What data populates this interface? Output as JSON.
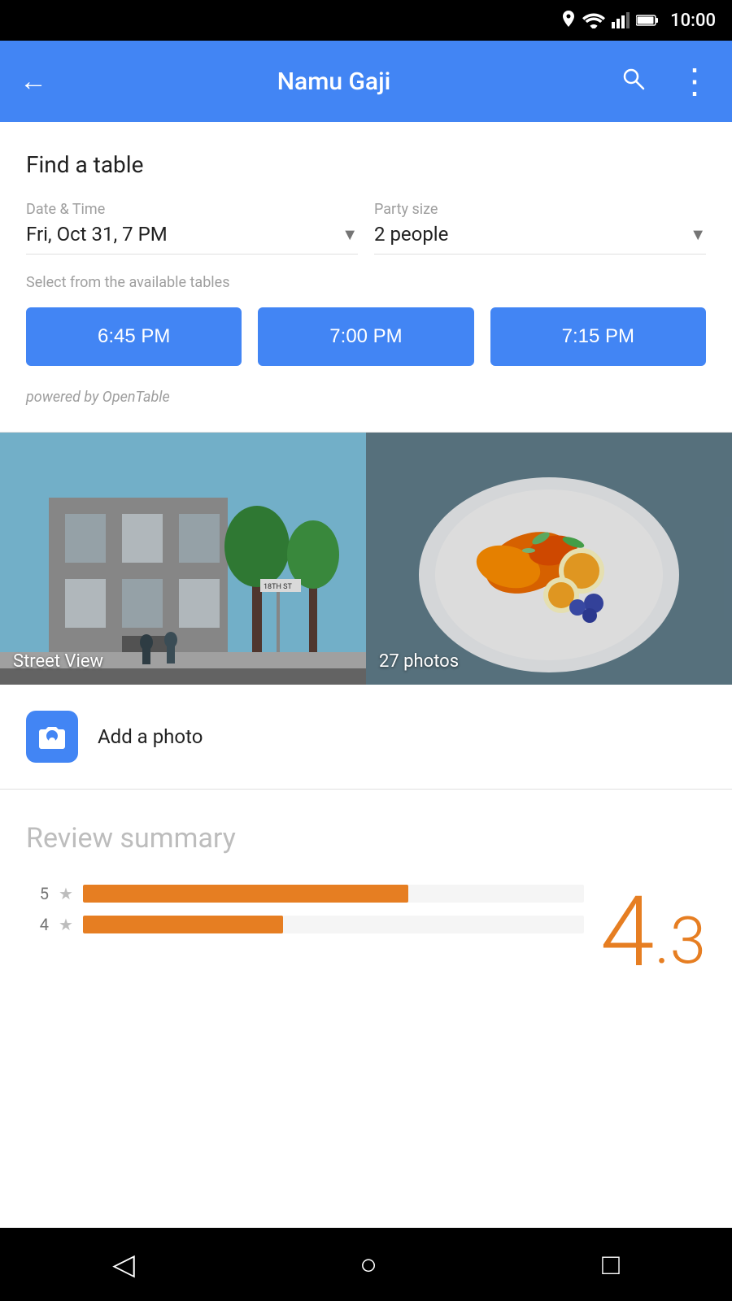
{
  "statusBar": {
    "time": "10:00"
  },
  "topBar": {
    "title": "Namu Gaji",
    "backLabel": "←",
    "searchLabel": "search",
    "moreLabel": "more"
  },
  "findTable": {
    "sectionTitle": "Find a table",
    "dateTimeLabel": "Date & Time",
    "dateTimeValue": "Fri, Oct 31, 7 PM",
    "partySizeLabel": "Party size",
    "partySizeValue": "2 people",
    "availableTablesLabel": "Select from the available tables",
    "timeSlots": [
      "6:45 PM",
      "7:00 PM",
      "7:15 PM"
    ],
    "poweredBy": "powered by OpenTable"
  },
  "photos": {
    "streetViewLabel": "Street View",
    "photosLabel": "27 photos",
    "addPhotoLabel": "Add a photo"
  },
  "reviewSummary": {
    "title": "Review summary",
    "overallRating": "4",
    "overallDecimal": ".3",
    "bars": [
      {
        "stars": "5",
        "widthPercent": 65
      },
      {
        "stars": "4",
        "widthPercent": 40
      }
    ]
  },
  "navBar": {
    "backIcon": "◁",
    "homeIcon": "○",
    "recentIcon": "□"
  }
}
